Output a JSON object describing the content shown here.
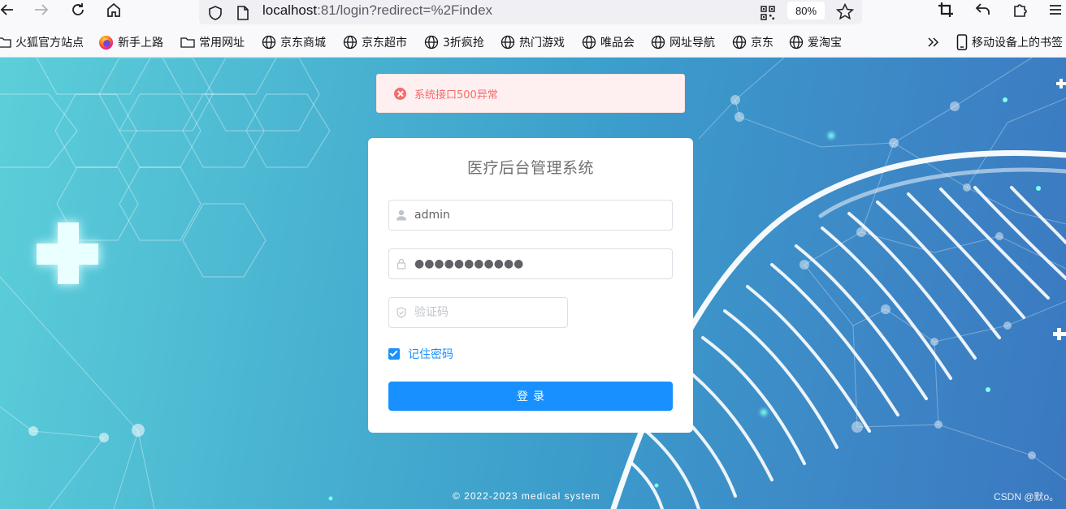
{
  "browser": {
    "url_host": "localhost",
    "url_rest": ":81/login?redirect=%2Findex",
    "zoom": "80%"
  },
  "bookmarks": [
    {
      "label": "火狐官方站点",
      "icon": "folder-icon"
    },
    {
      "label": "新手上路",
      "icon": "firefox-icon"
    },
    {
      "label": "常用网址",
      "icon": "folder-icon"
    },
    {
      "label": "京东商城",
      "icon": "globe-icon"
    },
    {
      "label": "京东超市",
      "icon": "globe-icon"
    },
    {
      "label": "3折疯抢",
      "icon": "globe-icon"
    },
    {
      "label": "热门游戏",
      "icon": "globe-icon"
    },
    {
      "label": "唯品会",
      "icon": "globe-icon"
    },
    {
      "label": "网址导航",
      "icon": "globe-icon"
    },
    {
      "label": "京东",
      "icon": "globe-icon"
    },
    {
      "label": "爱淘宝",
      "icon": "globe-icon"
    }
  ],
  "mobile_bookmarks": "移动设备上的书签",
  "alert": {
    "message": "系统接口500异常",
    "color": "#f56c6c"
  },
  "login": {
    "title": "医疗后台管理系统",
    "username": "admin",
    "password_mask": "●●●●●●●●●●●",
    "captcha_placeholder": "验证码",
    "remember_label": "记住密码",
    "remember_checked": true,
    "submit_label": "登录",
    "accent": "#1890ff"
  },
  "footer": "© 2022-2023 medical system",
  "watermark": "CSDN @默o。"
}
